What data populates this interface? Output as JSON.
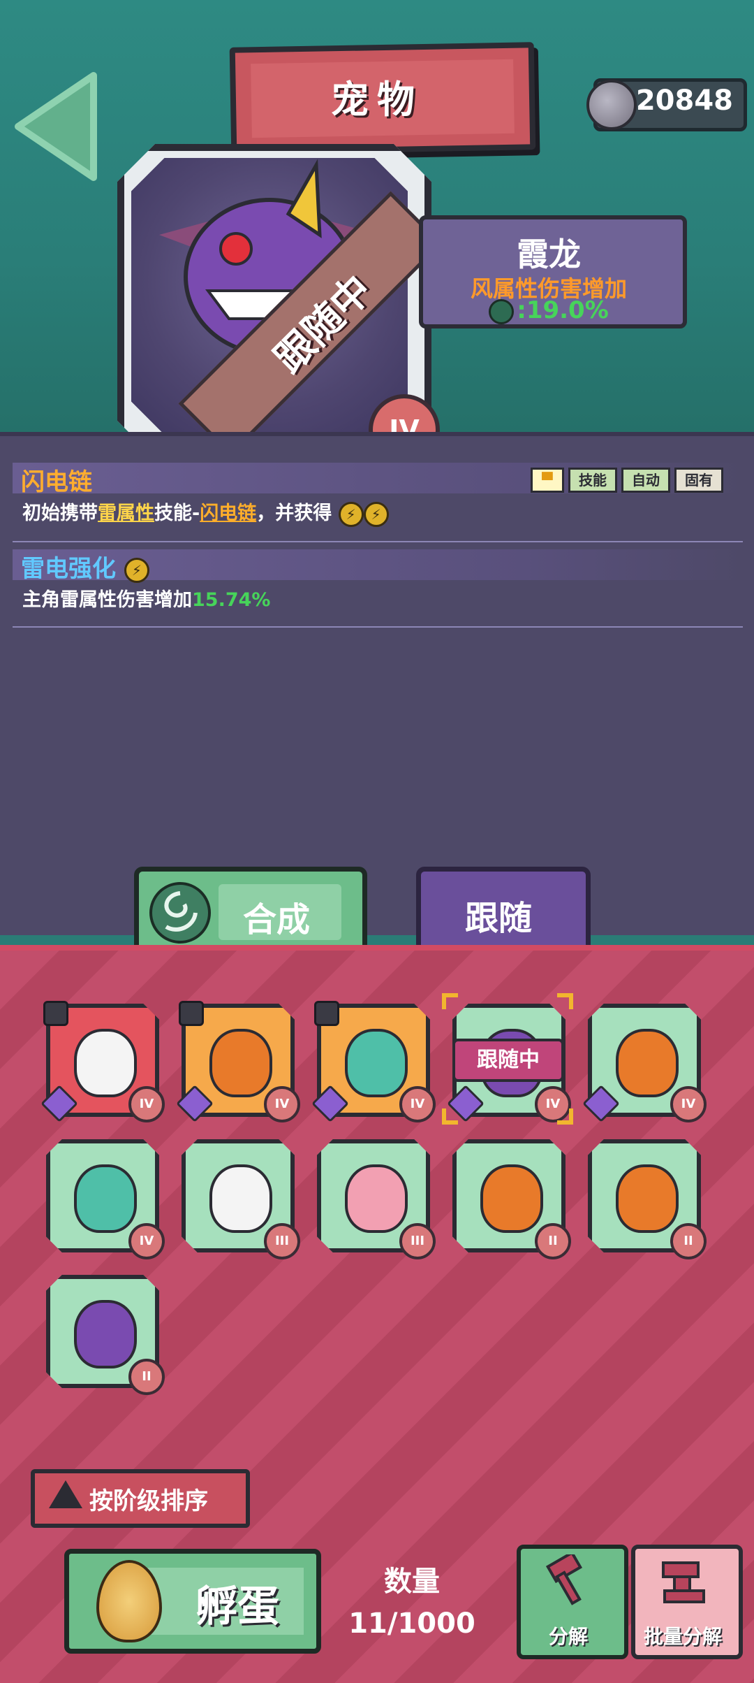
{
  "header": {
    "title": "宠物",
    "currency_value": "20848",
    "currency_icon": "skull-coin-icon",
    "back_icon": "back-arrow-icon"
  },
  "pet": {
    "name": "霞龙",
    "bonus_label": "风属性伤害增加",
    "bonus_value": ":19.0%",
    "bonus_icon": "wind-icon",
    "status_ribbon": "跟随中",
    "rank": "IV"
  },
  "skills": [
    {
      "title": "闪电链",
      "desc_prefix": "初始携带",
      "desc_element": "雷属性",
      "desc_mid": "技能-",
      "desc_skill": "闪电链",
      "desc_suffix": "，并获得",
      "tags": [
        "技能",
        "自动",
        "固有"
      ],
      "tag_icon": "shirt-icon"
    },
    {
      "title": "雷电强化",
      "desc_prefix": "主角雷属性伤害增加",
      "desc_value": "15.74%"
    }
  ],
  "tabs": {
    "synthesize": "合成",
    "follow": "跟随",
    "synthesize_icon": "wind-swirl-icon"
  },
  "inventory": {
    "following_tag": "跟随中",
    "items": [
      {
        "rank": "IV",
        "bg": "red",
        "creature": "skull-bat",
        "locked": true
      },
      {
        "rank": "IV",
        "bg": "orange",
        "creature": "flame-spider",
        "locked": true
      },
      {
        "rank": "IV",
        "bg": "orange",
        "creature": "spring-ghost",
        "locked": true
      },
      {
        "rank": "IV",
        "bg": "green",
        "creature": "purple-dragon",
        "locked": false,
        "following": true
      },
      {
        "rank": "IV",
        "bg": "green",
        "creature": "flame-spider",
        "locked": false
      },
      {
        "rank": "IV",
        "bg": "green",
        "creature": "spring-ghost",
        "locked": false
      },
      {
        "rank": "III",
        "bg": "green",
        "creature": "skull-bat",
        "locked": false
      },
      {
        "rank": "III",
        "bg": "green",
        "creature": "pink-fairy",
        "locked": false
      },
      {
        "rank": "II",
        "bg": "green",
        "creature": "flame-spider",
        "locked": false
      },
      {
        "rank": "II",
        "bg": "green",
        "creature": "flame-spider",
        "locked": false
      },
      {
        "rank": "II",
        "bg": "green",
        "creature": "purple-dragon",
        "locked": false
      }
    ]
  },
  "footer": {
    "sort_label": "按阶级排序",
    "hatch_label": "孵蛋",
    "count_label": "数量",
    "count_value": "11/1000",
    "decompose_label": "分解",
    "batch_decompose_label": "批量分解"
  },
  "colors": {
    "teal_bg": "#2b7c76",
    "purple_panel": "#4e4968",
    "pink_stripes": "#c24e6b",
    "green_button": "#6dbd8a",
    "orange_text": "#ff9a2a",
    "green_text": "#47d45a"
  }
}
